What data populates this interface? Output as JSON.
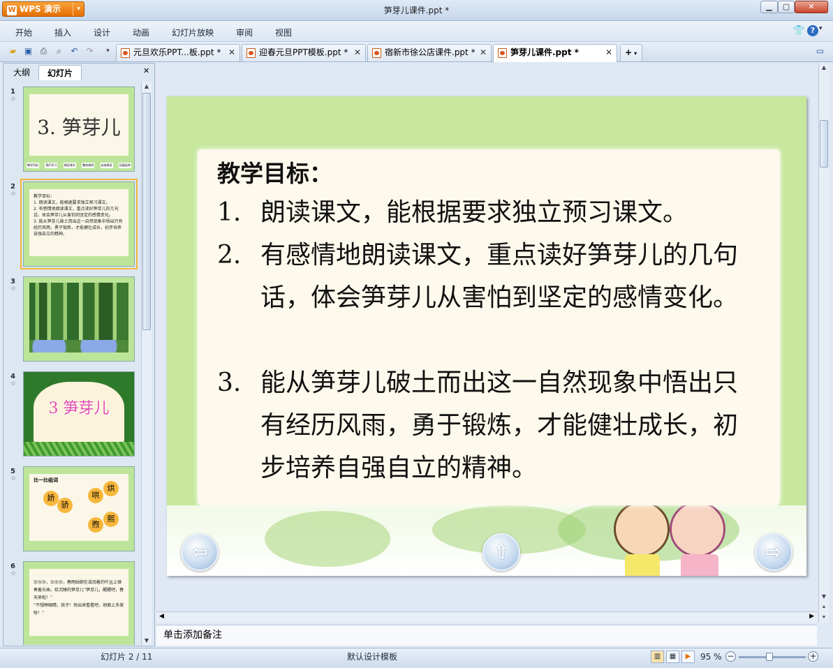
{
  "app": {
    "name": "WPS 演示",
    "logo": "W",
    "window_title": "笋芽儿课件.ppt *",
    "controls": {
      "minimize": "▁",
      "maximize": "▢",
      "close": "✕"
    }
  },
  "menu": {
    "items": [
      "开始",
      "插入",
      "设计",
      "动画",
      "幻灯片放映",
      "审阅",
      "视图"
    ],
    "right_icons": [
      "shirt-icon",
      "help-icon"
    ]
  },
  "quick_access": [
    "open-folder-icon",
    "save-icon",
    "print-icon",
    "print-preview-icon",
    "undo-icon",
    "redo-icon",
    "customize-icon"
  ],
  "doc_tabs": [
    {
      "label": "元旦欢乐PPT...板.ppt *",
      "active": false
    },
    {
      "label": "迎春元旦PPT模板.ppt *",
      "active": false
    },
    {
      "label": "宿新市徐公店课件.ppt *",
      "active": false
    },
    {
      "label": "笋芽儿课件.ppt *",
      "active": true
    }
  ],
  "new_tab": "+",
  "left_panel": {
    "tabs": [
      "大纲",
      "幻灯片"
    ],
    "active_tab": "幻灯片",
    "close": "✕",
    "thumbnails": [
      {
        "number": "1",
        "title": "3. 笋芽儿",
        "buttons": [
          "教学目标",
          "我们学习",
          "朗读课文",
          "整体感知",
          "自由朗读",
          "拓展延伸"
        ]
      },
      {
        "number": "2",
        "lines": [
          "教学目标：",
          "1. 朗读课文，能根据要求独立预习课文。",
          "2. 有感情地朗读课文，重点读好笋芽儿的几句话，体会笋芽儿从害怕到坚定的感情变化。",
          "3. 能从笋芽儿破土而出这一自然现象中悟出只有经历风雨，勇于锻炼，才能健壮成长，初步培养自强自立的精神。"
        ],
        "selected": true
      },
      {
        "number": "3",
        "kind": "bamboo-photo"
      },
      {
        "number": "4",
        "title": "3 笋芽儿"
      },
      {
        "number": "5",
        "heading": "比一比组词",
        "chars": [
          "娇",
          "骄",
          "哄",
          "烘",
          "煦",
          "熙"
        ]
      },
      {
        "number": "6",
        "lines": [
          "沙沙沙，沙沙沙，春雨姑娘在滋润着的叶丛上弹奏着乐曲，给沉睡的笋芽儿“笋芽儿，醒醒吧，春天来啦！”",
          "“不想睁眼睛，孩子！快出来看看吧，地面上多美呀！”"
        ]
      }
    ]
  },
  "slide": {
    "heading": "教学目标：",
    "objectives": [
      {
        "num": "1.",
        "text": "朗读课文，能根据要求独立预习课文。"
      },
      {
        "num": "2.",
        "text": "有感情地朗读课文，重点读好笋芽儿的几句话，体会笋芽儿从害怕到坚定的感情变化。"
      },
      {
        "num": "3.",
        "text": "能从笋芽儿破土而出这一自然现象中悟出只有经历风雨，勇于锻炼，才能健壮成长，初步培养自强自立的精神。"
      }
    ],
    "nav": {
      "prev": "⇦",
      "home": "⇧",
      "next": "⇨"
    }
  },
  "notes": {
    "placeholder": "单击添加备注"
  },
  "status": {
    "slide_counter": "幻灯片 2 / 11",
    "template": "默认设计模板",
    "zoom": "95 %",
    "zoom_level": 0.45,
    "zoom_minus": "−",
    "zoom_plus": "+"
  },
  "colors": {
    "accent": "#e46f06",
    "slide_bg": "#c6e79c",
    "card_bg": "#fdf9ec"
  }
}
